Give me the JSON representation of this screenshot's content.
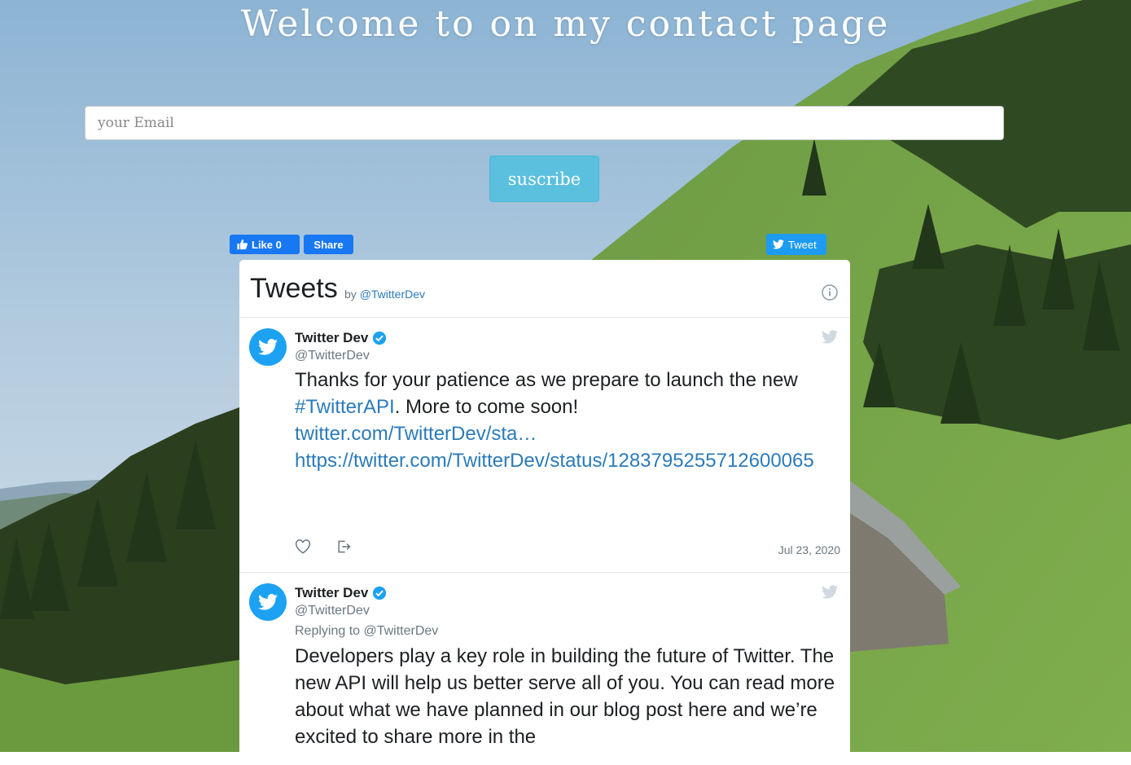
{
  "page": {
    "title": "Welcome to on my contact page"
  },
  "form": {
    "email_placeholder": "your Email",
    "subscribe_label": "suscribe"
  },
  "social": {
    "like_label": "Like 0",
    "share_label": "Share",
    "tweet_label": "Tweet"
  },
  "timeline": {
    "title": "Tweets",
    "by_prefix": "by",
    "by_handle": "@TwitterDev",
    "tweets": [
      {
        "author_name": "Twitter Dev",
        "author_handle": "@TwitterDev",
        "text_before": "Thanks for your patience as we prepare to launch the new ",
        "hashtag": "#TwitterAPI",
        "text_after": ". More to come soon! ",
        "short_link": "twitter.com/TwitterDev/sta…",
        "full_link": "https://twitter.com/TwitterDev/status/1283795255712600065",
        "date": "Jul 23, 2020"
      },
      {
        "author_name": "Twitter Dev",
        "author_handle": "@TwitterDev",
        "reply_to": "Replying to @TwitterDev",
        "text": "Developers play a key role in building the future of Twitter. The new API will help us better serve all of you. You can read more about what we have planned in our blog post here and we’re excited to share more in the"
      }
    ]
  },
  "colors": {
    "subscribe": "#5bc0de",
    "facebook": "#1877f2",
    "twitter": "#1da1f2",
    "link": "#2b7bb9"
  }
}
